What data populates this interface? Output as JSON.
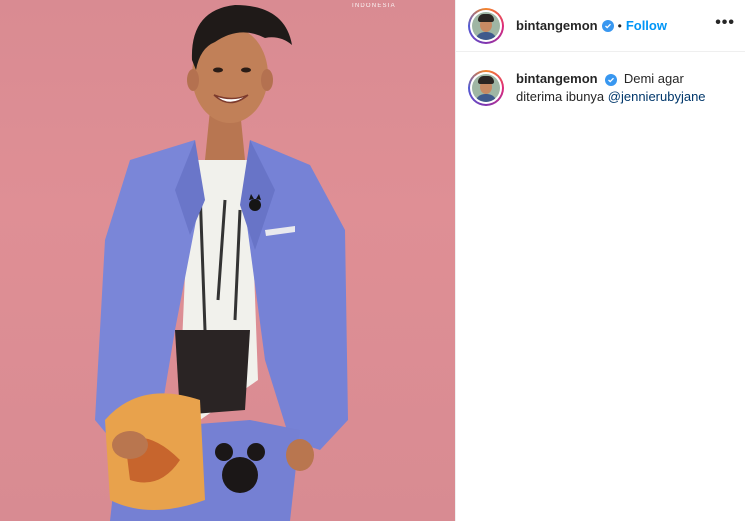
{
  "photo": {
    "watermark": "INDONESIA"
  },
  "header": {
    "username": "bintangemon",
    "separator": "•",
    "follow_label": "Follow",
    "more_label": "•••"
  },
  "caption": {
    "username": "bintangemon",
    "text": "Demi agar diterima ibunya ",
    "mention": "@jennierubyjane"
  },
  "icons": {
    "verified": "verified-badge-icon",
    "more": "more-options-icon"
  },
  "colors": {
    "photo_background": "#df8f95",
    "follow": "#0095f6",
    "verified": "#3897f0",
    "mention": "#00376b"
  }
}
